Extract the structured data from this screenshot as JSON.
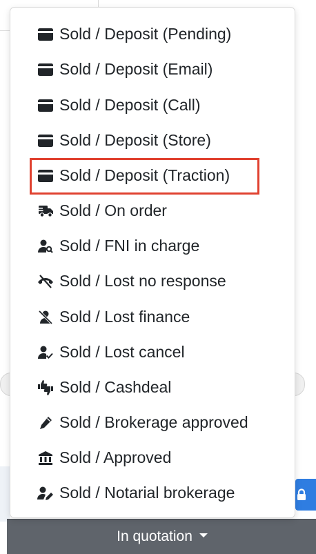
{
  "menu": {
    "items": [
      {
        "label": "Sold / Deposit (Pending)",
        "icon": "credit-card-icon"
      },
      {
        "label": "Sold / Deposit (Email)",
        "icon": "credit-card-icon"
      },
      {
        "label": "Sold / Deposit (Call)",
        "icon": "credit-card-icon"
      },
      {
        "label": "Sold / Deposit (Store)",
        "icon": "credit-card-icon"
      },
      {
        "label": "Sold / Deposit (Traction)",
        "icon": "credit-card-icon"
      },
      {
        "label": "Sold / On order",
        "icon": "truck-fast-icon"
      },
      {
        "label": "Sold / FNI in charge",
        "icon": "user-search-icon"
      },
      {
        "label": "Sold / Lost no response",
        "icon": "phone-slash-icon"
      },
      {
        "label": "Sold / Lost finance",
        "icon": "user-slash-icon"
      },
      {
        "label": "Sold / Lost cancel",
        "icon": "user-check-icon"
      },
      {
        "label": "Sold / Cashdeal",
        "icon": "thumbs-up-down-icon"
      },
      {
        "label": "Sold / Brokerage approved",
        "icon": "pen-icon"
      },
      {
        "label": "Sold / Approved",
        "icon": "bank-icon"
      },
      {
        "label": "Sold / Notarial brokerage",
        "icon": "user-pen-icon"
      }
    ],
    "highlighted_index": 4
  },
  "footer": {
    "status_label": "In quotation"
  },
  "colors": {
    "highlight": "#e0412f",
    "footer_bg": "#5f646b",
    "primary_button": "#2f7de1",
    "text": "#212529"
  }
}
